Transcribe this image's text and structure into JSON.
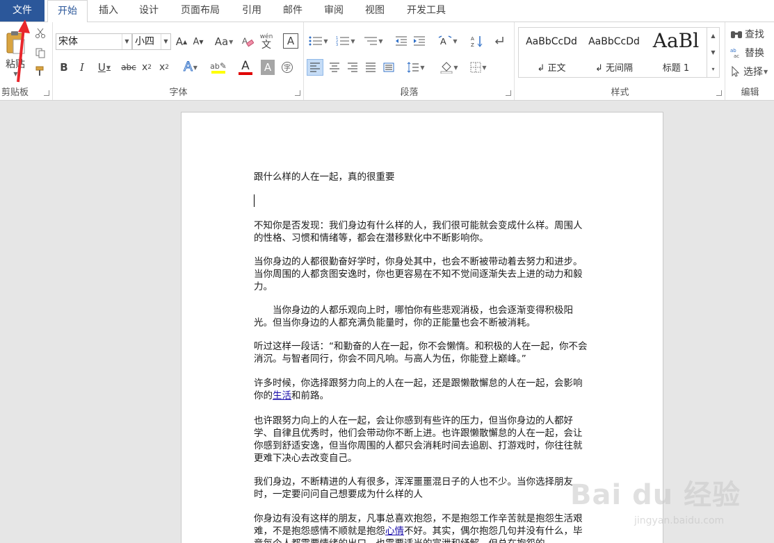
{
  "tabs": {
    "file": "文件",
    "home": "开始",
    "insert": "插入",
    "design": "设计",
    "layout": "页面布局",
    "references": "引用",
    "mailings": "邮件",
    "review": "审阅",
    "view": "视图",
    "developer": "开发工具"
  },
  "clipboard": {
    "paste": "粘贴",
    "label": "剪贴板"
  },
  "font": {
    "name": "宋体",
    "size": "小四",
    "label": "字体",
    "phonetic_guide": "wén",
    "phonetic_char": "文"
  },
  "paragraph": {
    "label": "段落"
  },
  "styles": {
    "label": "样式",
    "items": [
      {
        "sample": "AaBbCcDd",
        "name": "↲ 正文"
      },
      {
        "sample": "AaBbCcDd",
        "name": "↲ 无间隔"
      },
      {
        "sample": "AaBl",
        "name": "标题 1"
      }
    ]
  },
  "editing": {
    "label": "编辑",
    "find": "查找",
    "replace": "替换",
    "select": "选择"
  },
  "document": {
    "title": "跟什么样的人在一起，真的很重要",
    "p1": "不知你是否发现：我们身边有什么样的人，我们很可能就会变成什么样。周围人的性格、习惯和情绪等，都会在潜移默化中不断影响你。",
    "p2": "当你身边的人都很勤奋好学时，你身处其中，也会不断被带动着去努力和进步。当你周围的人都贪图安逸时，你也更容易在不知不觉间逐渐失去上进的动力和毅力。",
    "p3": "　　当你身边的人都乐观向上时，哪怕你有些悲观消极，也会逐渐变得积极阳光。但当你身边的人都充满负能量时，你的正能量也会不断被消耗。",
    "p4": "听过这样一段话：“和勤奋的人在一起，你不会懒惰。和积极的人在一起，你不会消沉。与智者同行，你会不同凡响。与高人为伍，你能登上巅峰。”",
    "p5_a": "许多时候，你选择跟努力向上的人在一起，还是跟懒散懈怠的人在一起，会影响你的",
    "p5_link": "生活",
    "p5_b": "和前路。",
    "p6": "也许跟努力向上的人在一起，会让你感到有些许的压力，但当你身边的人都好学、自律且优秀时，他们会带动你不断上进。也许跟懒散懈怠的人在一起，会让你感到舒适安逸，但当你周围的人都只会消耗时间去追剧、打游戏时，你往往就更难下决心去改变自己。",
    "p7": "我们身边，不断精进的人有很多，浑浑噩噩混日子的人也不少。当你选择朋友时，一定要问问自己想要成为什么样的人",
    "p8_a": "你身边有没有这样的朋友，凡事总喜欢抱怨，不是抱怨工作辛苦就是抱怨生活艰难，不是抱怨感情不顺就是抱怨",
    "p8_link": "心情",
    "p8_b": "不好。其实，偶尔抱怨几句并没有什么，毕竟每个人都需要情绪的出口，也需要适当的宣泄和纾解。但总在抱怨的"
  },
  "watermark": {
    "brand": "Bai du 经验",
    "url": "jingyan.baidu.com"
  },
  "colors": {
    "file_tab": "#2b579a",
    "accent": "#2b579a",
    "annotation": "#e8262b",
    "highlight": "#ffff00",
    "font_color": "#e00000"
  }
}
